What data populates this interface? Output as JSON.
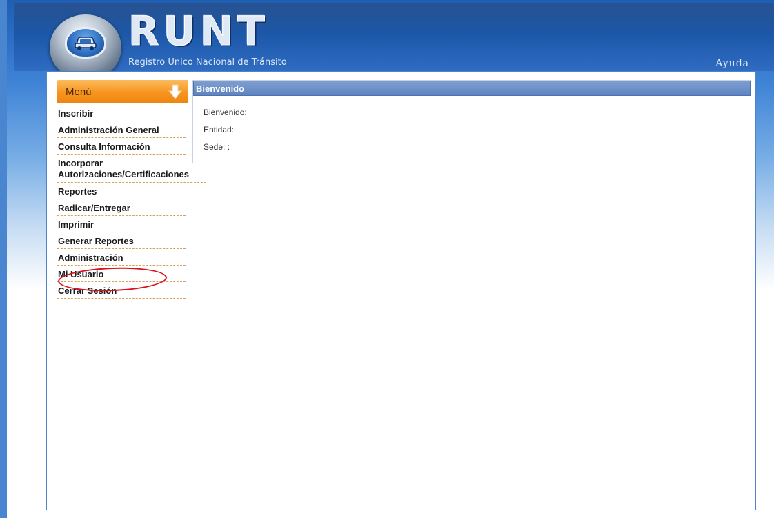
{
  "header": {
    "wordmark": "RUNT",
    "subtitle": "Registro Unico Nacional de Tránsito",
    "help_label": "Ayuda"
  },
  "sidebar": {
    "menu_title": "Menú",
    "items": [
      {
        "label": "Inscribir"
      },
      {
        "label": "Administración General"
      },
      {
        "label": "Consulta Información"
      },
      {
        "label_line1": "Incorporar",
        "label_line2": "Autorizaciones/Certificaciones"
      },
      {
        "label": "Reportes"
      },
      {
        "label": "Radicar/Entregar"
      },
      {
        "label": "Imprimir"
      },
      {
        "label": "Generar Reportes"
      },
      {
        "label": "Administración"
      },
      {
        "label": "Mi Usuario"
      },
      {
        "label": "Cerrar Sesión"
      }
    ]
  },
  "welcome": {
    "title": "Bienvenido",
    "rows": [
      {
        "label": "Bienvenido:"
      },
      {
        "label": "Entidad:"
      },
      {
        "label": "Sede:   :"
      }
    ]
  },
  "colors": {
    "menu_accent": "#f7941f",
    "header_blue": "#1c57a8",
    "panel_header": "#5f84c0",
    "highlight_ring": "#d8111b"
  }
}
